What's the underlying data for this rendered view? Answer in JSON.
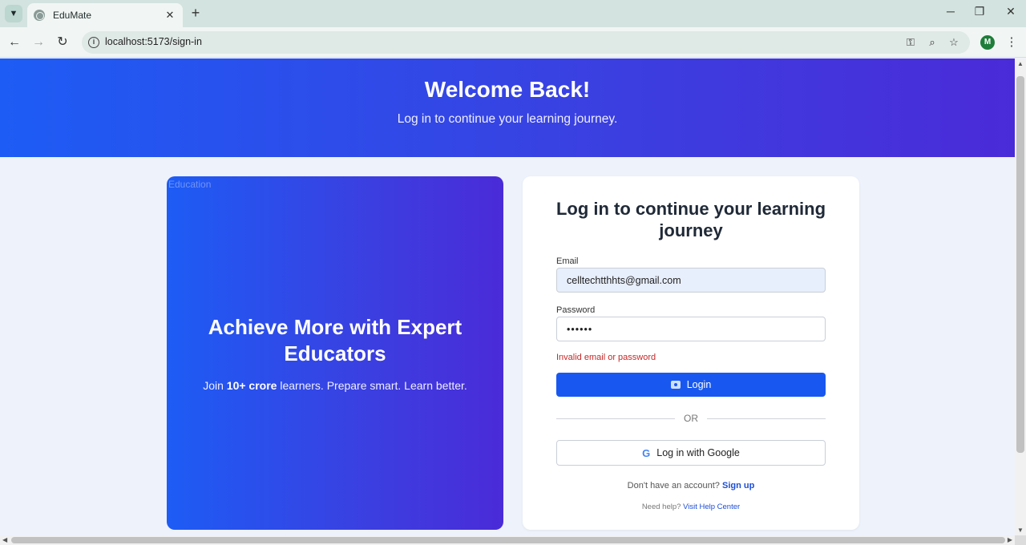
{
  "browser": {
    "tab_title": "EduMate",
    "tab_close": "✕",
    "new_tab": "+",
    "url": "localhost:5173/sign-in",
    "profile_initial": "M",
    "window_controls": {
      "minimize": "─",
      "restore": "❐",
      "close": "✕"
    },
    "nav": {
      "back": "←",
      "forward": "→",
      "reload": "↻"
    },
    "icons": {
      "tab_search": "chevron-down-icon",
      "favicon": "globe-icon",
      "site_info": "info-icon",
      "password_key": "key-icon",
      "zoom": "zoom-out-icon",
      "bookmark": "star-icon",
      "menu": "more-vert-icon"
    }
  },
  "hero": {
    "title": "Welcome Back!",
    "subtitle": "Log in to continue your learning journey."
  },
  "promo": {
    "image_alt": "Education",
    "heading": "Achieve More with Expert Educators",
    "text_prefix": "Join ",
    "text_bold": "10+ crore",
    "text_suffix": " learners. Prepare smart. Learn better."
  },
  "login_form": {
    "heading": "Log in to continue your learning journey",
    "email_label": "Email",
    "email_value": "celltechtthhts@gmail.com",
    "password_label": "Password",
    "password_value": "••••••",
    "error": "Invalid email or password",
    "login_button": "Login",
    "or_text": "OR",
    "google_button": "Log in with Google",
    "signup_prompt": "Don't have an account?",
    "signup_link": "Sign up",
    "help_prompt": "Need help?",
    "help_link": "Visit Help Center"
  },
  "colors": {
    "brand_blue": "#1958f0",
    "gradient_start": "#1d5cf5",
    "gradient_end": "#4a2bd8",
    "error_red": "#c62828"
  }
}
